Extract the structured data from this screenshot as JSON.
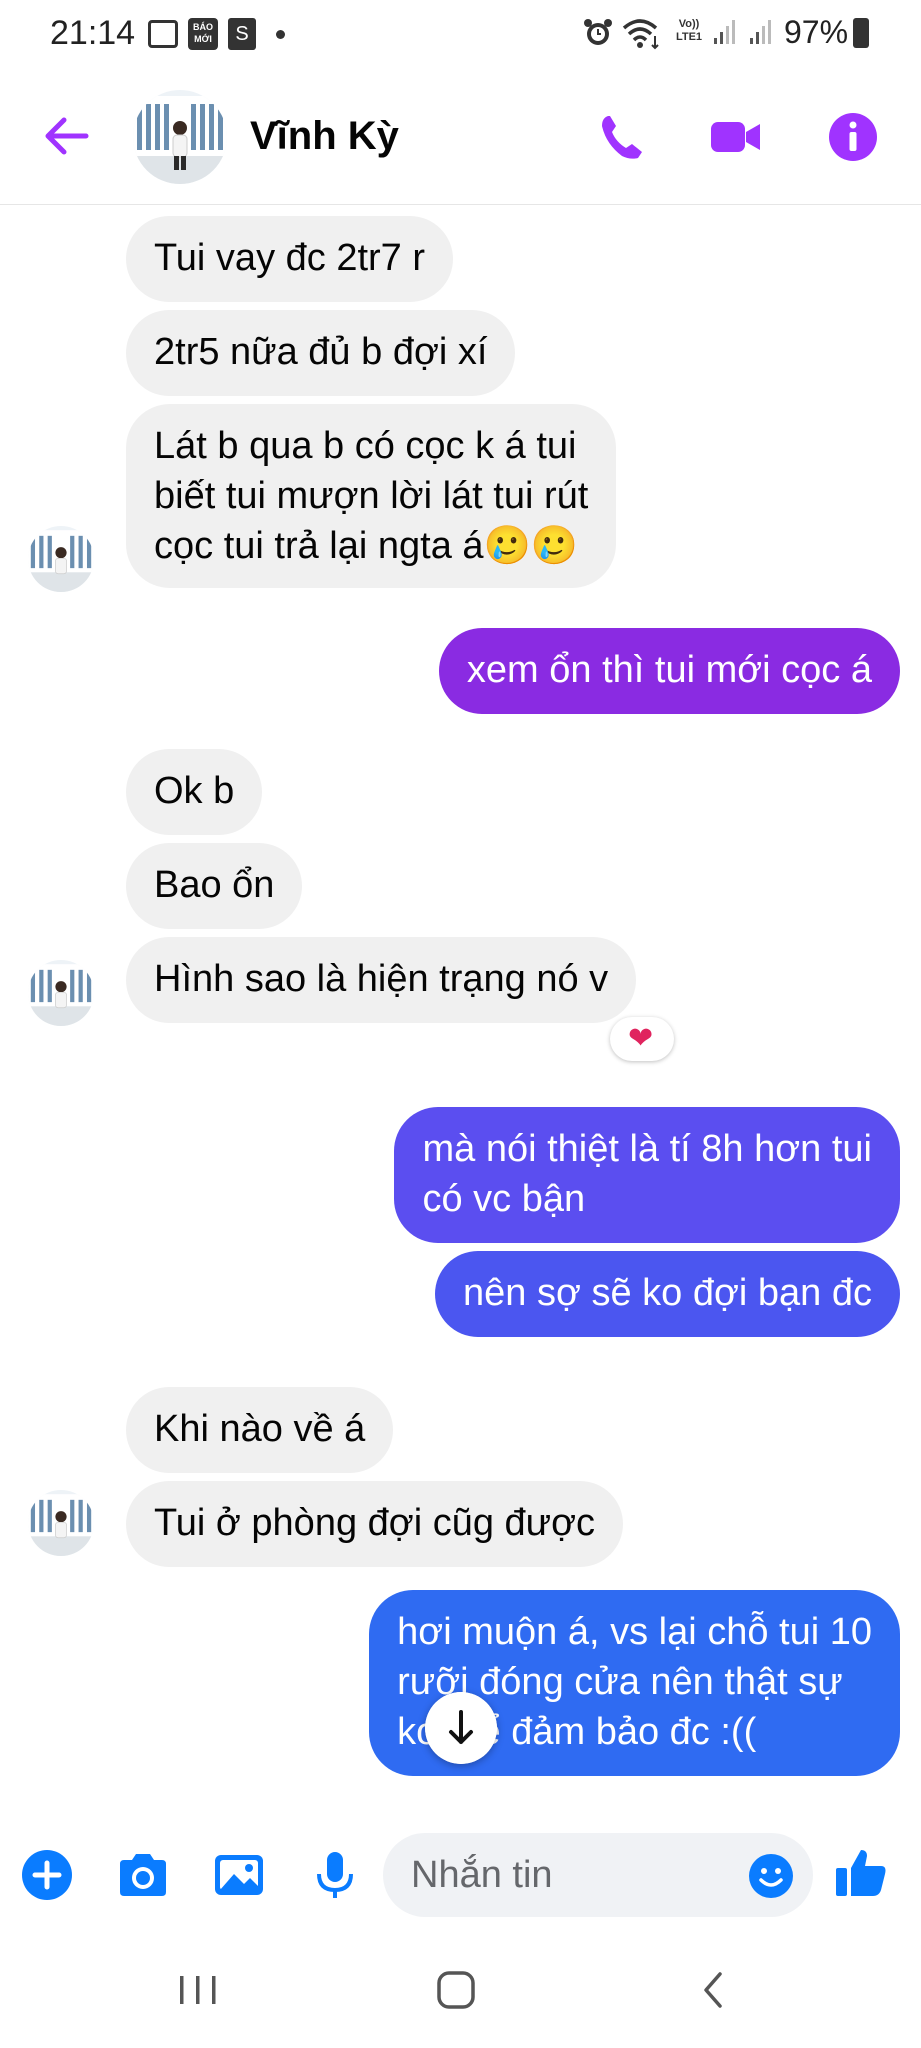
{
  "status_bar": {
    "time": "21:14",
    "baomoi_label": "BÁO MỚI",
    "volte_label": "Vo)) LTE1",
    "battery": "97%"
  },
  "header": {
    "contact_name": "Vĩnh Kỳ"
  },
  "messages": [
    {
      "side": "in",
      "text": "Tui vay đc 2tr7 r"
    },
    {
      "side": "in",
      "text": "2tr5 nữa đủ b đợi xí"
    },
    {
      "side": "in",
      "lines": [
        "Lát b qua b có cọc k á tui",
        "biết tui mượn lời lát tui rút",
        "cọc tui trả lại ngta á🥲🥲"
      ]
    },
    {
      "side": "out",
      "text": "xem ổn thì tui mới cọc á"
    },
    {
      "side": "in",
      "text": "Ok b"
    },
    {
      "side": "in",
      "text": "Bao ổn"
    },
    {
      "side": "in",
      "text": "Hình sao là hiện trạng nó v",
      "reaction": "❤"
    },
    {
      "side": "out",
      "lines": [
        "mà nói thiệt là tí 8h hơn tui",
        "có vc bận"
      ]
    },
    {
      "side": "out",
      "text": "nên sợ sẽ ko đợi bạn đc"
    },
    {
      "side": "in",
      "text": "Khi nào về á"
    },
    {
      "side": "in",
      "text": "Tui ở phòng đợi cũg được"
    },
    {
      "side": "out",
      "lines": [
        "hơi muộn á, vs lại chỗ tui 10",
        "rưỡi đóng cửa nên thật sự",
        "ko thể đảm bảo đc :(("
      ]
    }
  ],
  "composer": {
    "placeholder": "Nhắn tin"
  },
  "icons": {
    "back": "arrow-left-icon",
    "call": "phone-icon",
    "video": "video-camera-icon",
    "info": "info-icon",
    "plus": "plus-icon",
    "camera": "camera-icon",
    "gallery": "image-icon",
    "mic": "microphone-icon",
    "emoji": "smiley-icon",
    "like": "thumbs-up-icon",
    "scroll_down": "arrow-down-icon"
  },
  "colors": {
    "accent": "#a033ff",
    "incoming_bubble": "#f0f0f0",
    "outgoing_purple": "#8a2be2",
    "outgoing_indigo": "#5b4ef0",
    "outgoing_blue": "#2f6bf2",
    "composer_blue": "#0a7cff"
  }
}
